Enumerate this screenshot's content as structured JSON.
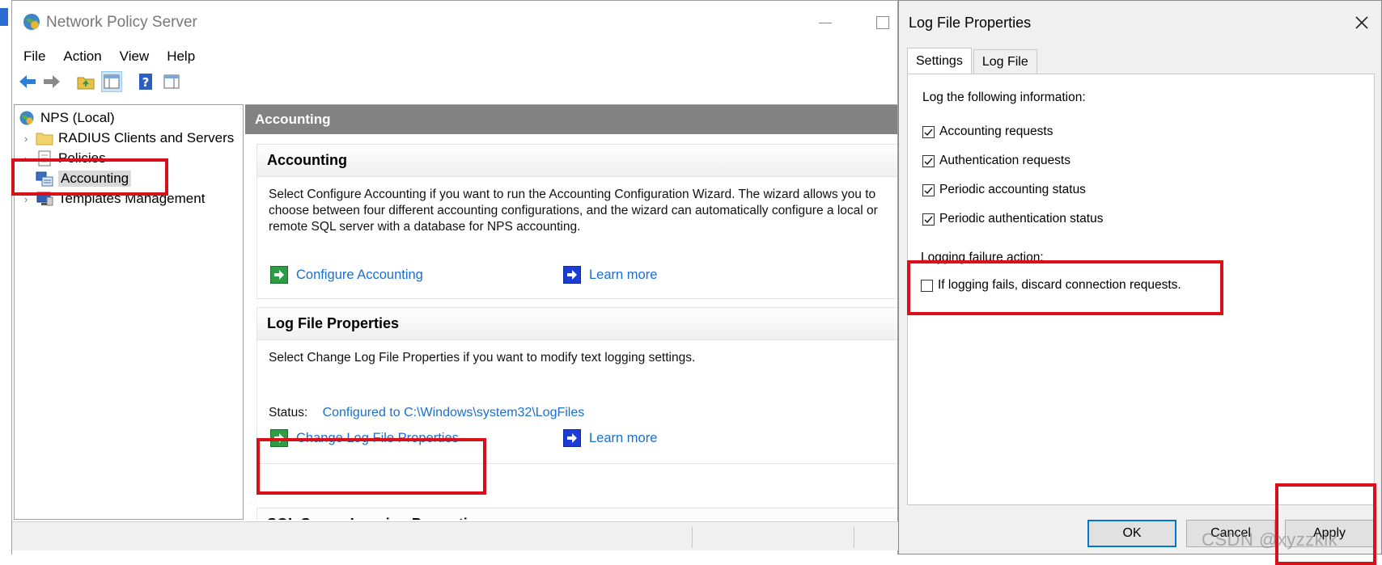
{
  "nps": {
    "title": "Network Policy Server",
    "menu": [
      "File",
      "Action",
      "View",
      "Help"
    ],
    "tree": [
      {
        "label": "NPS (Local)",
        "icon": "globe-icon"
      },
      {
        "label": "RADIUS Clients and Servers",
        "icon": "folder-icon"
      },
      {
        "label": "Policies",
        "icon": "policy-icon"
      },
      {
        "label": "Accounting",
        "icon": "accounting-icon"
      },
      {
        "label": "Templates Management",
        "icon": "computer-icon"
      }
    ],
    "content": {
      "header": "Accounting",
      "accounting": {
        "title": "Accounting",
        "desc": [
          "Select Configure Accounting if you want to run the Accounting Configuration Wizard. The wizard allows you to",
          "choose between four different accounting configurations, and the wizard can automatically configure a local or",
          "remote SQL server with a database for NPS accounting."
        ],
        "configure_link": "Configure Accounting",
        "learn_more": "Learn more"
      },
      "logfile": {
        "title": "Log File Properties",
        "desc": "Select Change Log File Properties if you want to modify text logging settings.",
        "status_label": "Status:",
        "status_value": "Configured to C:\\Windows\\system32\\LogFiles",
        "change_link": "Change Log File Properties",
        "learn_more": "Learn more"
      },
      "sql": {
        "title": "SQL Server Logging Properties"
      }
    }
  },
  "dialog": {
    "title": "Log File Properties",
    "tabs": [
      "Settings",
      "Log File"
    ],
    "intro": "Log the following information:",
    "checks": [
      {
        "label": "Accounting requests",
        "checked": true
      },
      {
        "label": "Authentication requests",
        "checked": true
      },
      {
        "label": "Periodic accounting status",
        "checked": true
      },
      {
        "label": "Periodic authentication status",
        "checked": true
      }
    ],
    "failure_heading": "Logging failure action:",
    "failure_check": {
      "label": "If logging fails, discard connection requests.",
      "checked": false
    },
    "buttons": {
      "ok": "OK",
      "cancel": "Cancel",
      "apply": "Apply"
    }
  },
  "watermark": "CSDN @xyzzklk",
  "colors": {
    "annotation": "#d9101a",
    "link": "#1a6fcf",
    "header": "#828282"
  }
}
